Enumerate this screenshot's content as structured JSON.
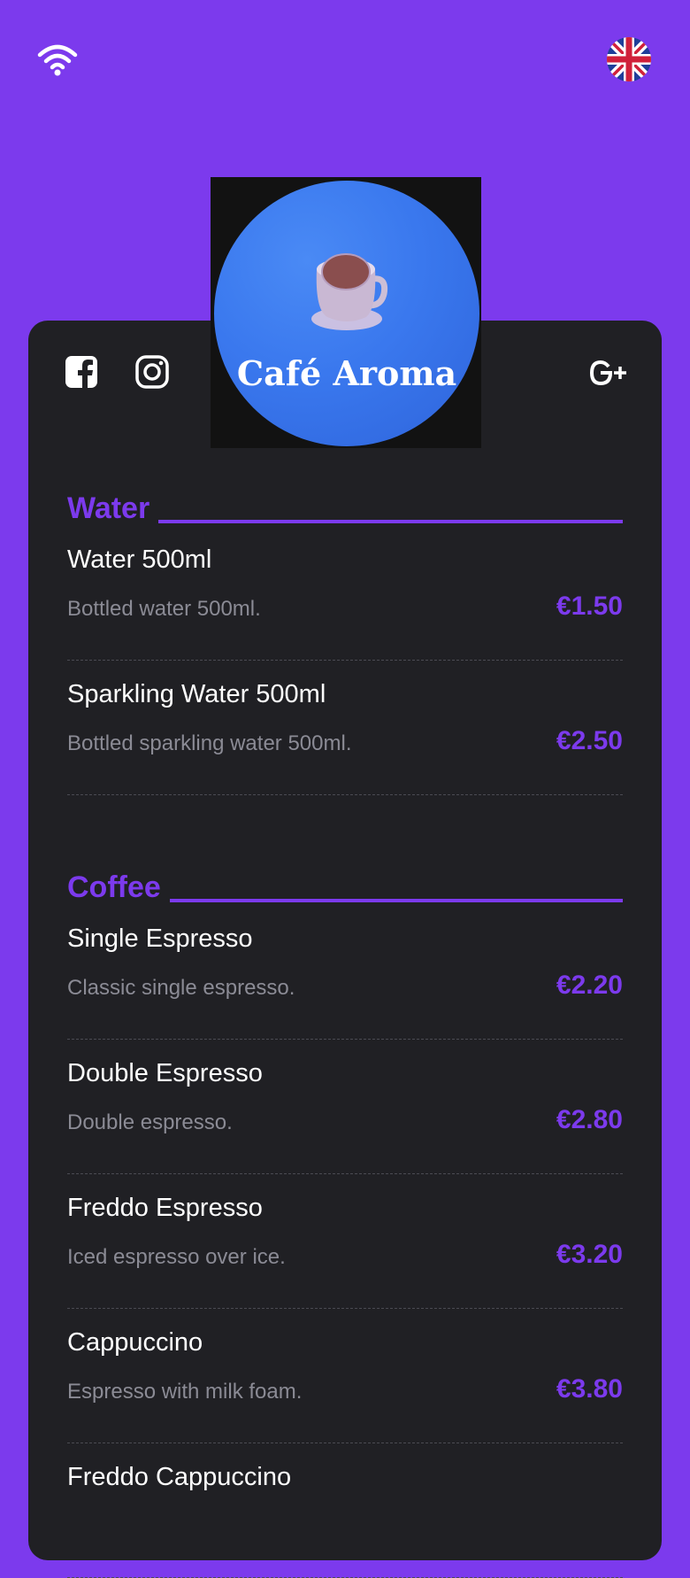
{
  "header": {
    "wifi_icon": "wifi-icon",
    "language_icon": "uk-flag-icon"
  },
  "social": {
    "facebook_icon": "facebook-icon",
    "instagram_icon": "instagram-icon",
    "google_plus_icon": "google-plus-icon"
  },
  "brand": {
    "name": "Café Aroma"
  },
  "colors": {
    "accent": "#7c3aed",
    "card": "#202024",
    "text": "#ffffff",
    "muted": "#8b8b95"
  },
  "menu": {
    "sections": [
      {
        "title": "Water",
        "items": [
          {
            "name": "Water 500ml",
            "description": "Bottled water 500ml.",
            "price": "€1.50"
          },
          {
            "name": "Sparkling Water 500ml",
            "description": "Bottled sparkling water 500ml.",
            "price": "€2.50"
          }
        ]
      },
      {
        "title": "Coffee",
        "items": [
          {
            "name": "Single Espresso",
            "description": "Classic single espresso.",
            "price": "€2.20"
          },
          {
            "name": "Double Espresso",
            "description": "Double espresso.",
            "price": "€2.80"
          },
          {
            "name": "Freddo Espresso",
            "description": "Iced espresso over ice.",
            "price": "€3.20"
          },
          {
            "name": "Cappuccino",
            "description": "Espresso with milk foam.",
            "price": "€3.80"
          },
          {
            "name": "Freddo Cappuccino",
            "description": "",
            "price": ""
          }
        ]
      }
    ]
  }
}
